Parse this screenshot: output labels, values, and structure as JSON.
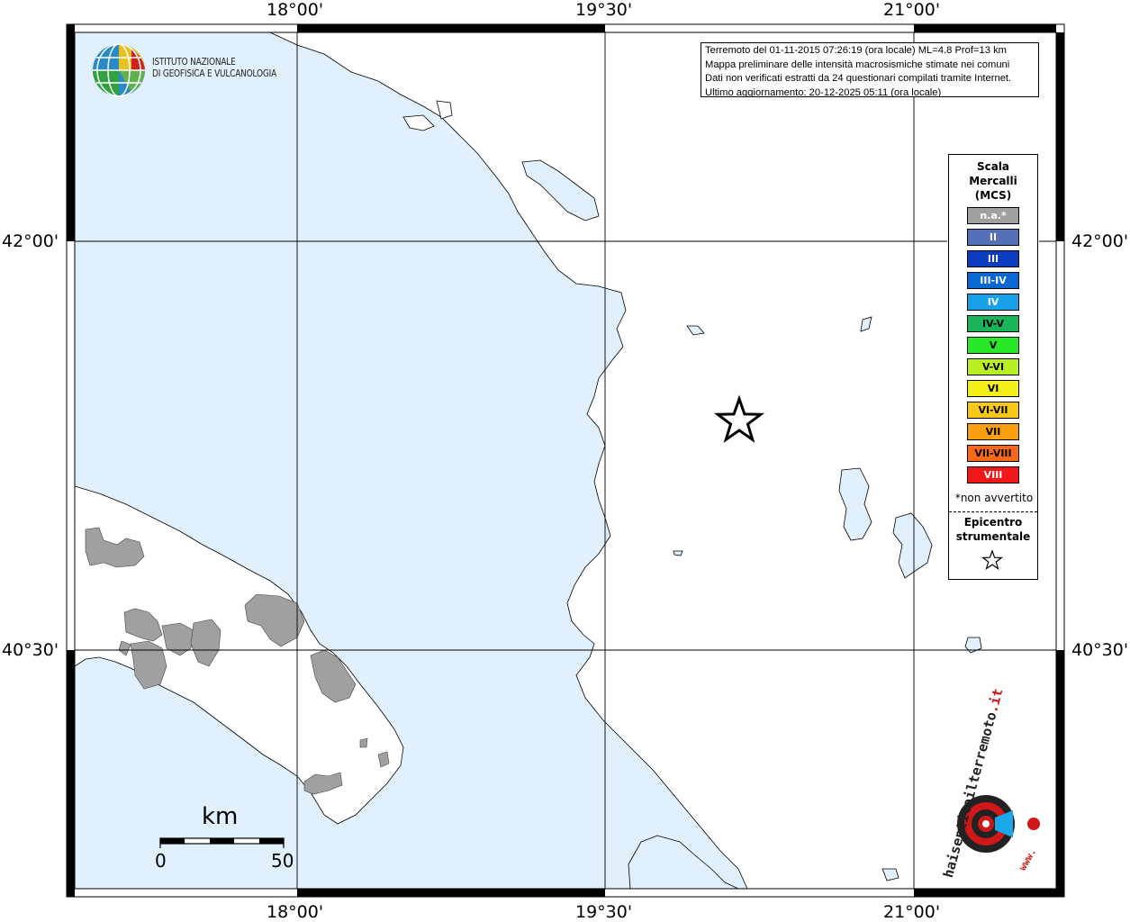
{
  "map": {
    "top_ticks": [
      "18°00'",
      "19°30'",
      "21°00'"
    ],
    "bottom_ticks": [
      "18°00'",
      "19°30'",
      "21°00'"
    ],
    "left_ticks": [
      "42°00'",
      "40°30'"
    ],
    "right_ticks": [
      "42°00'",
      "40°30'"
    ],
    "sea_color": "#e0f0fc",
    "land_color": "#ffffff",
    "felt_area_color": "#a0a0a0"
  },
  "info": {
    "line1": "Terremoto del 01-11-2015 07:26:19 (ora locale) ML=4.8 Prof=13 km",
    "line2": "Mappa preliminare delle intensità macrosismiche stimate nei comuni",
    "line3": "Dati non verificati estratti da 24 questionari compilati tramite Internet.",
    "line4": "Ultimo aggiornamento: 20-12-2025 05:11 (ora locale)"
  },
  "ingv_logo": {
    "line1": "ISTITUTO NAZIONALE",
    "line2": "DI GEOFISICA E VULCANOLOGIA"
  },
  "legend": {
    "title1": "Scala",
    "title2": "Mercalli",
    "title3": "(MCS)",
    "items": [
      {
        "label": "n.a.*",
        "color": "#a0a0a0",
        "text_color": "#ffffff"
      },
      {
        "label": "II",
        "color": "#5470b8",
        "text_color": "#ffffff"
      },
      {
        "label": "III",
        "color": "#0c3cc0",
        "text_color": "#ffffff"
      },
      {
        "label": "III-IV",
        "color": "#0a68d4",
        "text_color": "#ffffff"
      },
      {
        "label": "IV",
        "color": "#18a0e8",
        "text_color": "#ffffff"
      },
      {
        "label": "IV-V",
        "color": "#1ab45a",
        "text_color": "#000000"
      },
      {
        "label": "V",
        "color": "#28e828",
        "text_color": "#000000"
      },
      {
        "label": "V-VI",
        "color": "#b8f024",
        "text_color": "#000000"
      },
      {
        "label": "VI",
        "color": "#f4f018",
        "text_color": "#000000"
      },
      {
        "label": "VI-VII",
        "color": "#f8c818",
        "text_color": "#000000"
      },
      {
        "label": "VII",
        "color": "#f8a010",
        "text_color": "#000000"
      },
      {
        "label": "VII-VIII",
        "color": "#f86818",
        "text_color": "#000000"
      },
      {
        "label": "VIII",
        "color": "#f01818",
        "text_color": "#ffffff"
      }
    ],
    "note": "*non avvertito",
    "epi1": "Epicentro",
    "epi2": "strumentale"
  },
  "scale_bar": {
    "unit": "km",
    "start": "0",
    "end": "50"
  },
  "hsi_logo": {
    "text1": "haisentitoilterremoto",
    "text2": ".it",
    "text3": "www."
  }
}
